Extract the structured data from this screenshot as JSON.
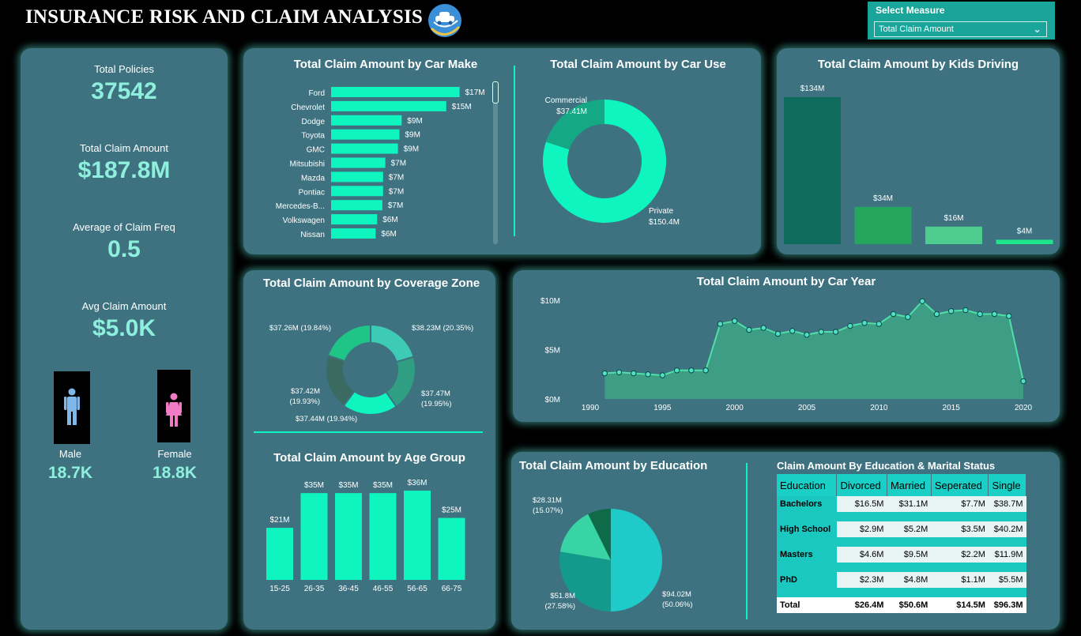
{
  "header": {
    "title": "INSURANCE RISK AND CLAIM ANALYSIS",
    "logo_icon": "car-cloud-icon"
  },
  "measure": {
    "label": "Select Measure",
    "value": "Total Claim Amount"
  },
  "kpis": {
    "policies_label": "Total Policies",
    "policies_value": "37542",
    "claim_label": "Total Claim Amount",
    "claim_value": "$187.8M",
    "freq_label": "Average of Claim Freq",
    "freq_value": "0.5",
    "avg_label": "Avg Claim Amount",
    "avg_value": "$5.0K",
    "male_label": "Male",
    "male_value": "18.7K",
    "female_label": "Female",
    "female_value": "18.8K"
  },
  "colors": {
    "accent": "#0ef5c0",
    "panel": "#3e7280",
    "glow": "#5aebdc"
  },
  "chart_data": [
    {
      "id": "make",
      "type": "bar",
      "orientation": "horizontal",
      "title": "Total Claim Amount by Car Make",
      "categories": [
        "Ford",
        "Chevrolet",
        "Dodge",
        "Toyota",
        "GMC",
        "Mitsubishi",
        "Mazda",
        "Pontiac",
        "Mercedes-B...",
        "Volkswagen",
        "Nissan"
      ],
      "values": [
        17,
        15,
        9,
        9,
        9,
        7,
        7,
        7,
        7,
        6,
        6
      ],
      "value_widths": [
        17.3,
        15.5,
        9.5,
        9.2,
        9.0,
        7.3,
        7.0,
        7.0,
        6.9,
        6.2,
        6.0
      ],
      "labels": [
        "$17M",
        "$15M",
        "$9M",
        "$9M",
        "$9M",
        "$7M",
        "$7M",
        "$7M",
        "$7M",
        "$6M",
        "$6M"
      ],
      "color": "#0ef5c0"
    },
    {
      "id": "use",
      "type": "pie",
      "donut": true,
      "title": "Total Claim Amount by Car Use",
      "categories": [
        "Private",
        "Commercial"
      ],
      "values": [
        150.4,
        37.41
      ],
      "labels": [
        "$150.4M",
        "$37.41M"
      ],
      "colors": [
        "#0ef5c0",
        "#14a884"
      ]
    },
    {
      "id": "kids",
      "type": "bar",
      "title": "Total Claim Amount by Kids Driving",
      "values": [
        134,
        34,
        16,
        4
      ],
      "labels": [
        "$134M",
        "$34M",
        "$16M",
        "$4M"
      ],
      "colors": [
        "#0f6b5c",
        "#24a65e",
        "#4ecb8e",
        "#1ee68a"
      ]
    },
    {
      "id": "zone",
      "type": "pie",
      "donut": true,
      "title": "Total Claim Amount by Coverage Zone",
      "values": [
        38.23,
        37.47,
        37.44,
        37.42,
        37.26
      ],
      "labels": [
        "$38.23M (20.35%)",
        "$37.47M (19.95%)",
        "$37.44M (19.94%)",
        "$37.42M (19.93%)",
        "$37.26M (19.84%)"
      ],
      "colors": [
        "#3ecbb5",
        "#2f9e82",
        "#0ef5c0",
        "#3a6a60",
        "#1fc487"
      ]
    },
    {
      "id": "year",
      "type": "area",
      "title": "Total Claim Amount by Car Year",
      "x": [
        1990,
        1991,
        1992,
        1993,
        1994,
        1995,
        1996,
        1997,
        1998,
        1999,
        2000,
        2001,
        2002,
        2003,
        2004,
        2005,
        2006,
        2007,
        2008,
        2009,
        2010,
        2011,
        2012,
        2013,
        2014,
        2015,
        2016,
        2017,
        2018,
        2019,
        2020
      ],
      "y": [
        1.9,
        2.6,
        2.7,
        2.6,
        2.5,
        2.4,
        2.9,
        2.9,
        2.9,
        7.6,
        7.9,
        7.0,
        7.2,
        6.6,
        6.9,
        6.5,
        6.8,
        6.8,
        7.4,
        7.7,
        7.6,
        8.6,
        8.3,
        9.9,
        8.6,
        8.9,
        9.0,
        8.6,
        8.6,
        8.4,
        1.8
      ],
      "xticks": [
        "1990",
        "1995",
        "2000",
        "2005",
        "2010",
        "2015",
        "2020"
      ],
      "yticks": [
        "$0M",
        "$5M",
        "$10M"
      ],
      "ylim": [
        0,
        10
      ],
      "color": "#4ee0a8"
    },
    {
      "id": "age",
      "type": "bar",
      "title": "Total Claim Amount by Age Group",
      "categories": [
        "15-25",
        "26-35",
        "36-45",
        "46-55",
        "56-65",
        "66-75"
      ],
      "values": [
        21,
        35,
        35,
        35,
        36,
        25
      ],
      "labels": [
        "$21M",
        "$35M",
        "$35M",
        "$35M",
        "$36M",
        "$25M"
      ],
      "color": "#0ef5c0"
    },
    {
      "id": "edu",
      "type": "pie",
      "title": "Total Claim Amount by Education",
      "values": [
        94.02,
        51.8,
        28.31,
        13.7
      ],
      "labels": [
        "$94.02M (50.06%)",
        "$51.8M (27.58%)",
        "$28.31M (15.07%)",
        ""
      ],
      "colors": [
        "#1ecbc8",
        "#139a8c",
        "#39d4a6",
        "#0e6a48"
      ]
    },
    {
      "id": "edu_table",
      "type": "table",
      "title": "Claim Amount By Education & Marital Status",
      "columns": [
        "Education",
        "Divorced",
        "Married",
        "Seperated",
        "Single"
      ],
      "rows": [
        [
          "Bachelors",
          "$16.5M",
          "$31.1M",
          "$7.7M",
          "$38.7M"
        ],
        [
          "High School",
          "$2.9M",
          "$5.2M",
          "$3.5M",
          "$40.2M"
        ],
        [
          "Masters",
          "$4.6M",
          "$9.5M",
          "$2.2M",
          "$11.9M"
        ],
        [
          "PhD",
          "$2.3M",
          "$4.8M",
          "$1.1M",
          "$5.5M"
        ]
      ],
      "total": [
        "Total",
        "$26.4M",
        "$50.6M",
        "$14.5M",
        "$96.3M"
      ]
    }
  ]
}
